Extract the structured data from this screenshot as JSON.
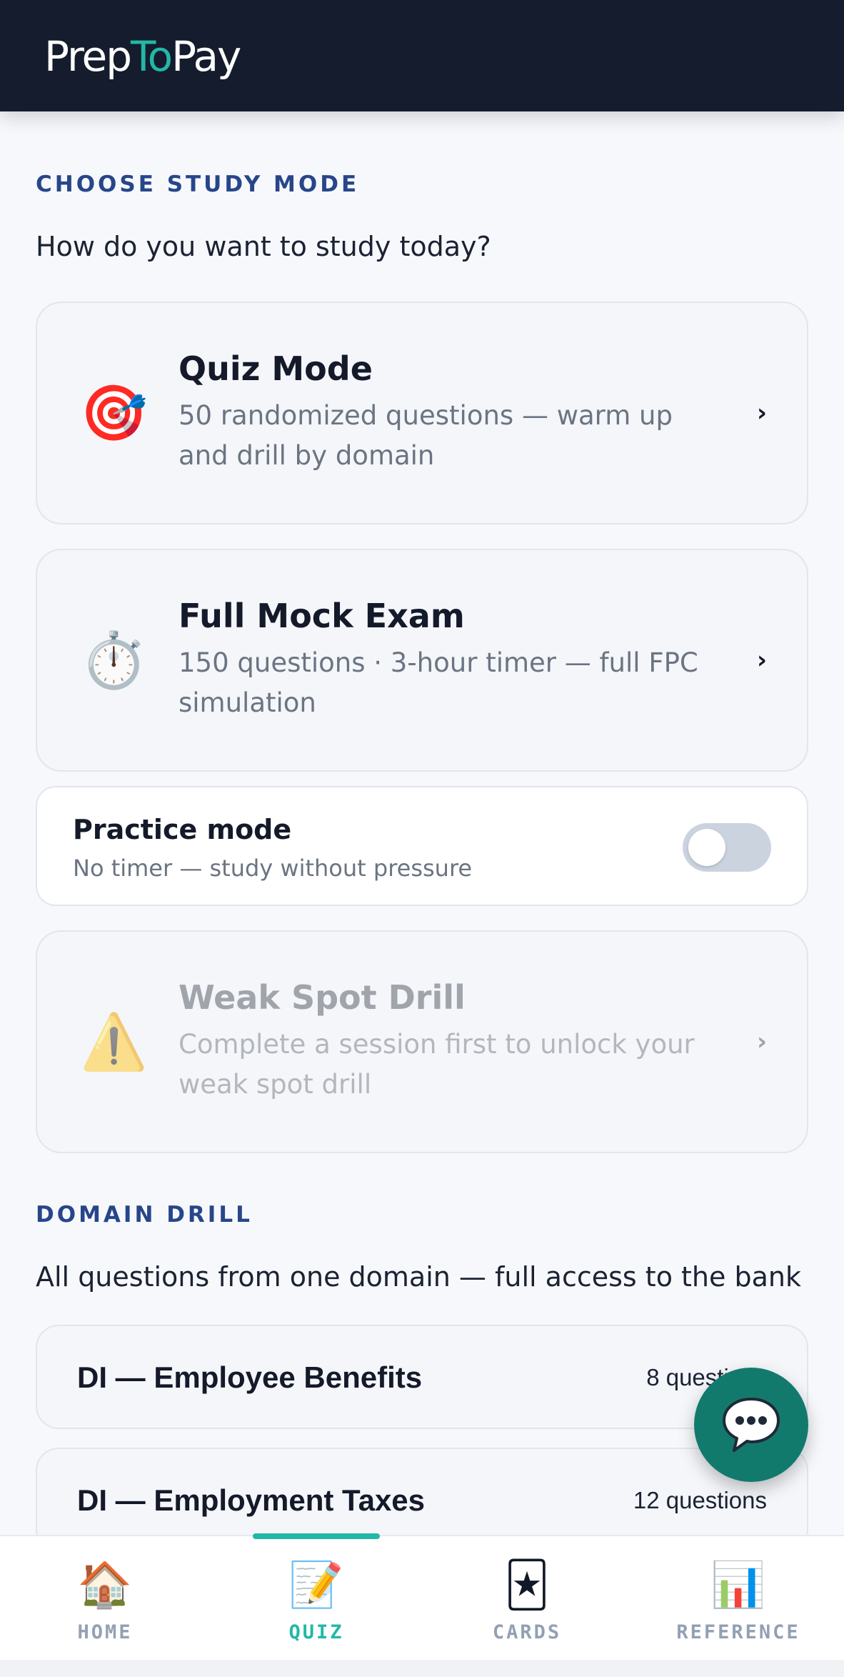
{
  "app": {
    "brand_part1": "Prep",
    "brand_part2": "To",
    "brand_part3": "Pay",
    "accent_color": "#22b8a6",
    "header_color": "#141c2d"
  },
  "study_mode": {
    "label": "CHOOSE STUDY MODE",
    "subtitle": "How do you want to study today?",
    "quiz": {
      "icon": "🎯",
      "title": "Quiz Mode",
      "desc_line1": "50 randomized questions — warm up",
      "desc_line2": "and drill by domain",
      "chevron": "›"
    },
    "mock": {
      "icon": "⏱️",
      "title": "Full Mock Exam",
      "desc_line1": "150 questions · 3-hour timer — full FPC",
      "desc_line2": "simulation",
      "chevron": "›"
    },
    "practice": {
      "title": "Practice mode",
      "desc": "No timer — study without pressure",
      "enabled": false
    },
    "weak_spot": {
      "icon": "⚠️",
      "title": "Weak Spot Drill",
      "desc_line1": "Complete a session first to unlock your",
      "desc_line2": "weak spot drill",
      "chevron": "›",
      "locked": true
    }
  },
  "domain_drill": {
    "label": "DOMAIN DRILL",
    "subtitle": "All questions from one domain — full access to the bank",
    "items": [
      {
        "name": "DI — Employee Benefits",
        "count": "8 questions"
      },
      {
        "name": "DI — Employment Taxes",
        "count": "12 questions"
      }
    ]
  },
  "fab": {
    "icon": "chat-bubble-icon"
  },
  "nav": {
    "items": [
      {
        "icon": "🏠",
        "label": "HOME",
        "active": false
      },
      {
        "icon": "📝",
        "label": "QUIZ",
        "active": true
      },
      {
        "icon": "🃏",
        "label": "CARDS",
        "active": false
      },
      {
        "icon": "📊",
        "label": "REFERENCE",
        "active": false
      }
    ]
  }
}
